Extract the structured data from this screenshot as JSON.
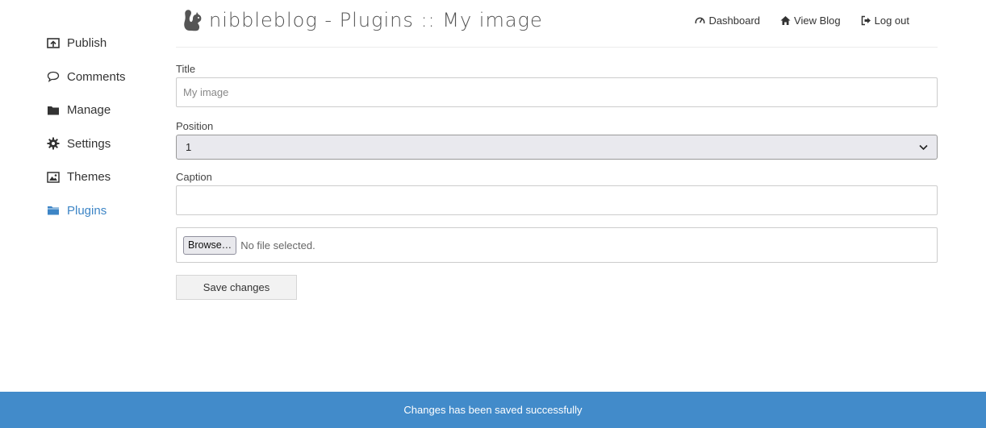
{
  "header": {
    "brand": "nibbleblog - Plugins :: My image",
    "nav": [
      {
        "label": "Dashboard",
        "icon": "dashboard-gauge-icon"
      },
      {
        "label": "View Blog",
        "icon": "home-icon"
      },
      {
        "label": "Log out",
        "icon": "logout-icon"
      }
    ]
  },
  "sidebar": {
    "items": [
      {
        "label": "Publish",
        "icon": "publish-upload-icon",
        "active": false
      },
      {
        "label": "Comments",
        "icon": "comment-bubble-icon",
        "active": false
      },
      {
        "label": "Manage",
        "icon": "folder-icon",
        "active": false
      },
      {
        "label": "Settings",
        "icon": "gear-icon",
        "active": false
      },
      {
        "label": "Themes",
        "icon": "picture-icon",
        "active": false
      },
      {
        "label": "Plugins",
        "icon": "folder-open-icon",
        "active": true
      }
    ]
  },
  "form": {
    "title_label": "Title",
    "title_placeholder": "My image",
    "title_value": "",
    "position_label": "Position",
    "position_value": "1",
    "caption_label": "Caption",
    "caption_value": "",
    "browse_label": "Browse…",
    "file_status": "No file selected.",
    "save_label": "Save changes"
  },
  "footer": {
    "message": "Changes has been saved successfully"
  },
  "colors": {
    "accent": "#3d85c6",
    "footer_bg": "#428bca"
  }
}
